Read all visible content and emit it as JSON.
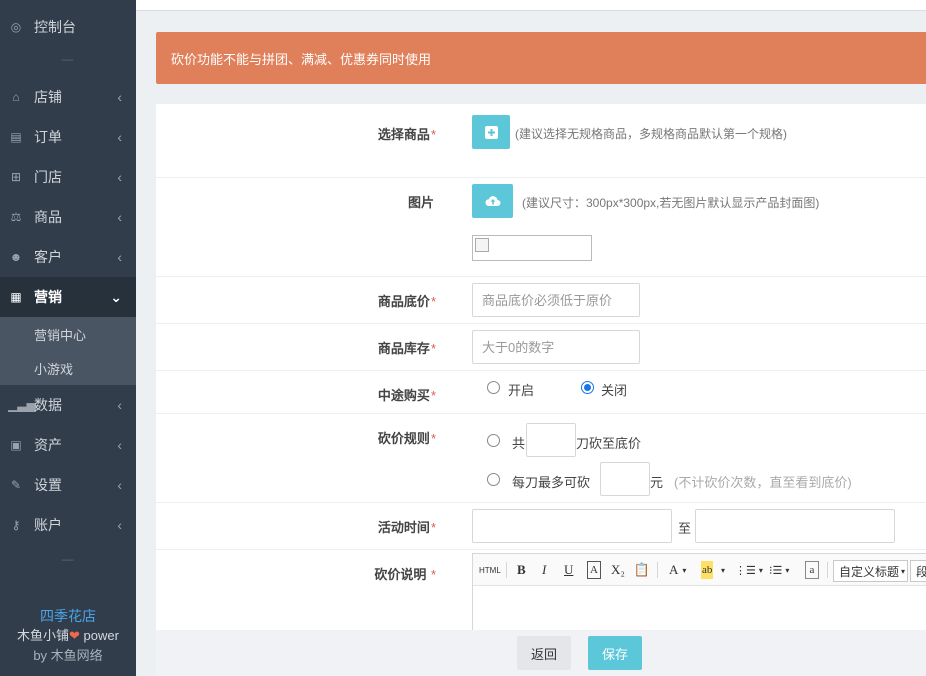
{
  "sidebar": {
    "items": [
      {
        "label": "控制台",
        "icon": "dashboard-icon"
      },
      {
        "label": "店铺",
        "icon": "store-icon"
      },
      {
        "label": "订单",
        "icon": "order-icon"
      },
      {
        "label": "门店",
        "icon": "sitemap-icon"
      },
      {
        "label": "商品",
        "icon": "scale-icon"
      },
      {
        "label": "客户",
        "icon": "users-icon"
      },
      {
        "label": "营销",
        "icon": "gift-icon"
      },
      {
        "label": "数据",
        "icon": "bar-chart-icon"
      },
      {
        "label": "资产",
        "icon": "money-icon"
      },
      {
        "label": "设置",
        "icon": "wrench-icon"
      },
      {
        "label": "账户",
        "icon": "key-icon"
      }
    ],
    "subitems": [
      {
        "label": "营销中心"
      },
      {
        "label": "小游戏"
      }
    ],
    "brand": {
      "shop": "四季花店",
      "line1_prefix": "木鱼小铺",
      "line1_suffix": " power",
      "line2": "by 木鱼网络"
    }
  },
  "alert": "砍价功能不能与拼团、满减、优惠券同时使用",
  "form": {
    "select_goods": {
      "label": "选择商品",
      "hint": "(建议选择无规格商品，多规格商品默认第一个规格)"
    },
    "image": {
      "label": "图片",
      "hint": "(建议尺寸：300px*300px,若无图片默认显示产品封面图)"
    },
    "base_price": {
      "label": "商品底价",
      "placeholder": "商品底价必须低于原价",
      "value": ""
    },
    "stock": {
      "label": "商品库存",
      "placeholder": "大于0的数字",
      "value": ""
    },
    "midway_buy": {
      "label": "中途购买",
      "options": [
        "开启",
        "关闭"
      ],
      "selected": "关闭"
    },
    "rule": {
      "label": "砍价规则",
      "opt1_prefix": "共",
      "opt1_suffix": "刀砍至底价",
      "opt2_prefix": "每刀最多可砍",
      "opt2_suffix": "元",
      "opt2_note": "(不计砍价次数，直至看到底价)",
      "value1": "",
      "value2": ""
    },
    "time": {
      "label": "活动时间",
      "separator": "至",
      "start": "",
      "end": ""
    },
    "desc": {
      "label": "砍价说明",
      "toolbar": [
        "HTML",
        "B",
        "I",
        "U",
        "A",
        "X₂",
        "paste",
        "A",
        "ab",
        "ol",
        "ul",
        "a"
      ],
      "heading_select": "自定义标题",
      "para_select": "段"
    }
  },
  "actions": {
    "back": "返回",
    "save": "保存"
  },
  "colors": {
    "alert": "#e0805b",
    "accent": "#5bc7d9",
    "sidebar": "#313d4b",
    "required": "#e15b4c"
  }
}
